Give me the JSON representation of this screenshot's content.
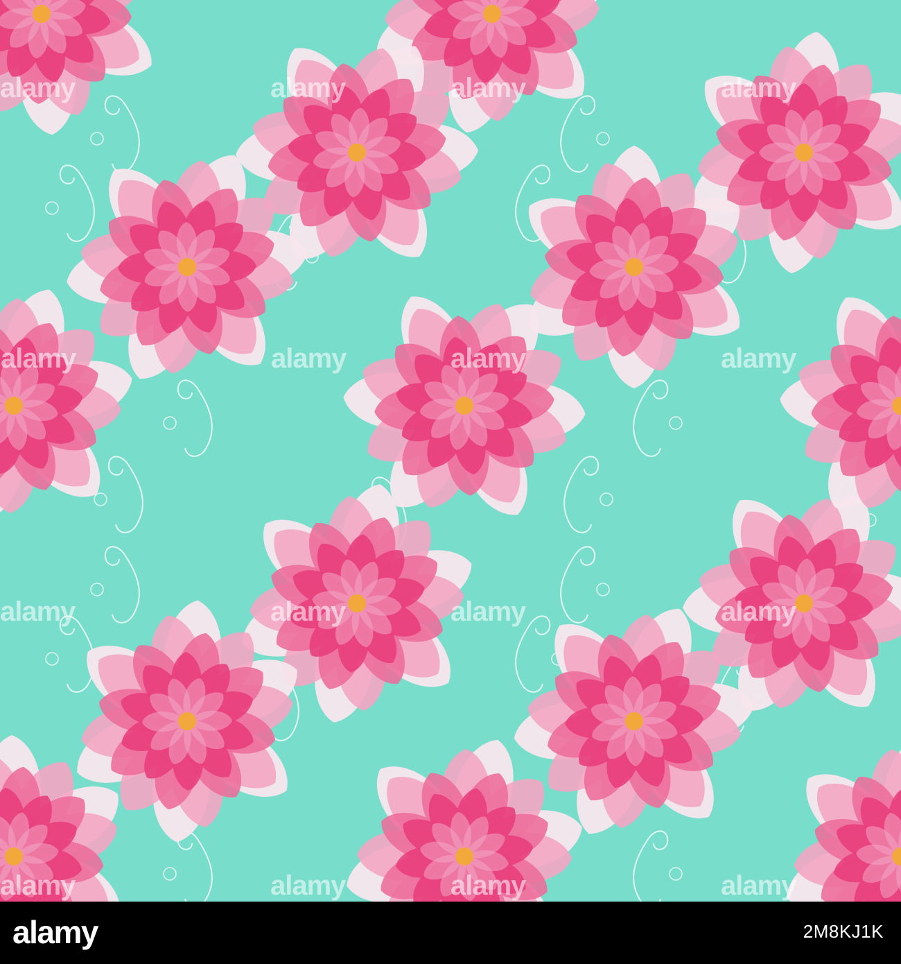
{
  "image": {
    "subject": "seamless floral pattern",
    "colors": {
      "background": "#79DDCC",
      "petal_deep": "#E83E7A",
      "petal_mid": "#EC6F9B",
      "petal_light": "#F3A6C2",
      "petal_white": "#F7E6EC",
      "center": "#F2A83A",
      "swirl": "#F2FBF8"
    }
  },
  "watermark": {
    "text": "alamy",
    "color": "#FFFFFF"
  },
  "footer": {
    "logo_text": "alamy",
    "image_id": "2M8KJ1K",
    "background": "#000000",
    "logo_color": "#FFFFFF"
  }
}
